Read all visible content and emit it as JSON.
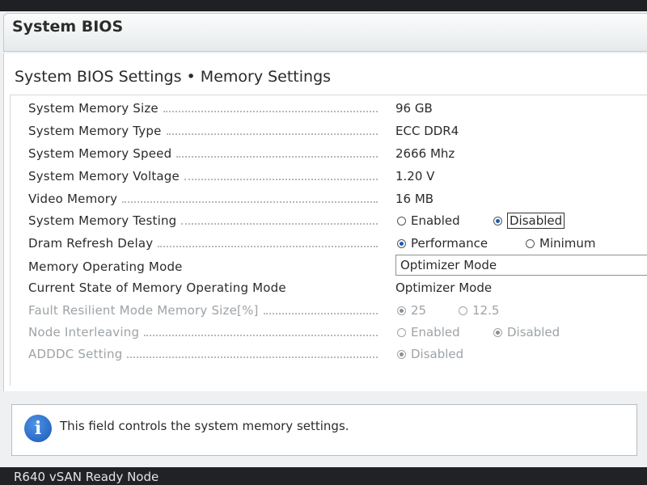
{
  "header": {
    "title": "System BIOS"
  },
  "page": {
    "subtitle": "System BIOS Settings • Memory Settings"
  },
  "settings": {
    "memory_size": {
      "label": "System Memory Size",
      "value": "96 GB"
    },
    "memory_type": {
      "label": "System Memory Type",
      "value": "ECC DDR4"
    },
    "memory_speed": {
      "label": "System Memory Speed",
      "value": "2666 Mhz"
    },
    "memory_voltage": {
      "label": "System Memory Voltage",
      "value": "1.20 V"
    },
    "video_memory": {
      "label": "Video Memory",
      "value": "16 MB"
    },
    "memory_testing": {
      "label": "System Memory Testing",
      "options": [
        "Enabled",
        "Disabled"
      ],
      "selected": "Disabled"
    },
    "dram_refresh": {
      "label": "Dram Refresh Delay",
      "options": [
        "Performance",
        "Minimum"
      ],
      "selected": "Performance"
    },
    "operating_mode": {
      "label": "Memory Operating Mode",
      "value": "Optimizer Mode"
    },
    "current_mode": {
      "label": "Current State of Memory Operating Mode",
      "value": "Optimizer Mode"
    },
    "fault_resilient": {
      "label": "Fault Resilient Mode Memory Size[%]",
      "options": [
        "25",
        "12.5"
      ],
      "selected": "25"
    },
    "node_interleaving": {
      "label": "Node Interleaving",
      "options": [
        "Enabled",
        "Disabled"
      ],
      "selected": "Disabled"
    },
    "adddc": {
      "label": "ADDDC Setting",
      "options": [
        "Disabled"
      ],
      "selected": "Disabled"
    }
  },
  "help": {
    "icon": "info-icon",
    "text": "This field controls the system memory settings."
  },
  "footer": {
    "text": "R640 vSAN Ready Node"
  }
}
